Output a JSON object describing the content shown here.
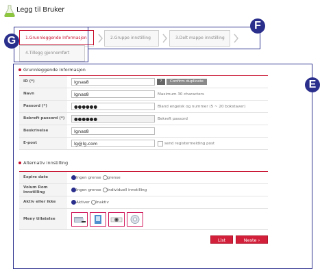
{
  "header": {
    "title": "Legg til Bruker",
    "icon": "flask-icon"
  },
  "tabs": [
    {
      "label": "1.Grunnleggende Informasjon",
      "active": true
    },
    {
      "label": "2.Gruppe innstilling",
      "active": false
    },
    {
      "label": "3.Delt mappe innstilling",
      "active": false
    },
    {
      "label": "4.Tillegg gjennomført",
      "active": false
    }
  ],
  "badges": {
    "g": "G",
    "f": "F",
    "e": "E"
  },
  "basic": {
    "title": "Grunnleggende Informasjon",
    "id_label": "ID (*)",
    "id_value": "Ignas8",
    "help_label": "?",
    "confirm_label": "Confirm duplicate",
    "name_label": "Navn",
    "name_value": "Ignas8",
    "name_hint": "Maximum 30 characters",
    "password_label": "Passord (*)",
    "password_value": "●●●●●●",
    "password_hint": "Bland engelsk og nummer (5 ~ 20 bokstaver)",
    "confirm_pw_label": "Bekreft passord (*)",
    "confirm_pw_value": "●●●●●●",
    "confirm_pw_hint": "Bekreft passord",
    "desc_label": "Beskrivelse",
    "desc_value": "Ignas8",
    "email_label": "E-post",
    "email_value": "lg@lg.com",
    "email_check_label": "send registermelding post"
  },
  "alt": {
    "title": "Alternativ innstilling",
    "expire_label": "Expire date",
    "expire_opt1": "Ingen grense",
    "expire_opt2": "grense",
    "volume_label": "Volum Rom innstilling",
    "volume_opt1": "Ingen grense",
    "volume_opt2": "Individuell innstilling",
    "active_label": "Aktiv eller ikke",
    "active_opt1": "Aktiver",
    "active_opt2": "Inaktiv",
    "menu_label": "Meny tillatelse",
    "menu_icons": [
      "folder-icon",
      "phone-icon",
      "camera-icon",
      "gear-icon"
    ]
  },
  "buttons": {
    "list": "List",
    "next": "Neste ›"
  },
  "colors": {
    "accent": "#c8102e",
    "annotation": "#2b2f8c"
  }
}
